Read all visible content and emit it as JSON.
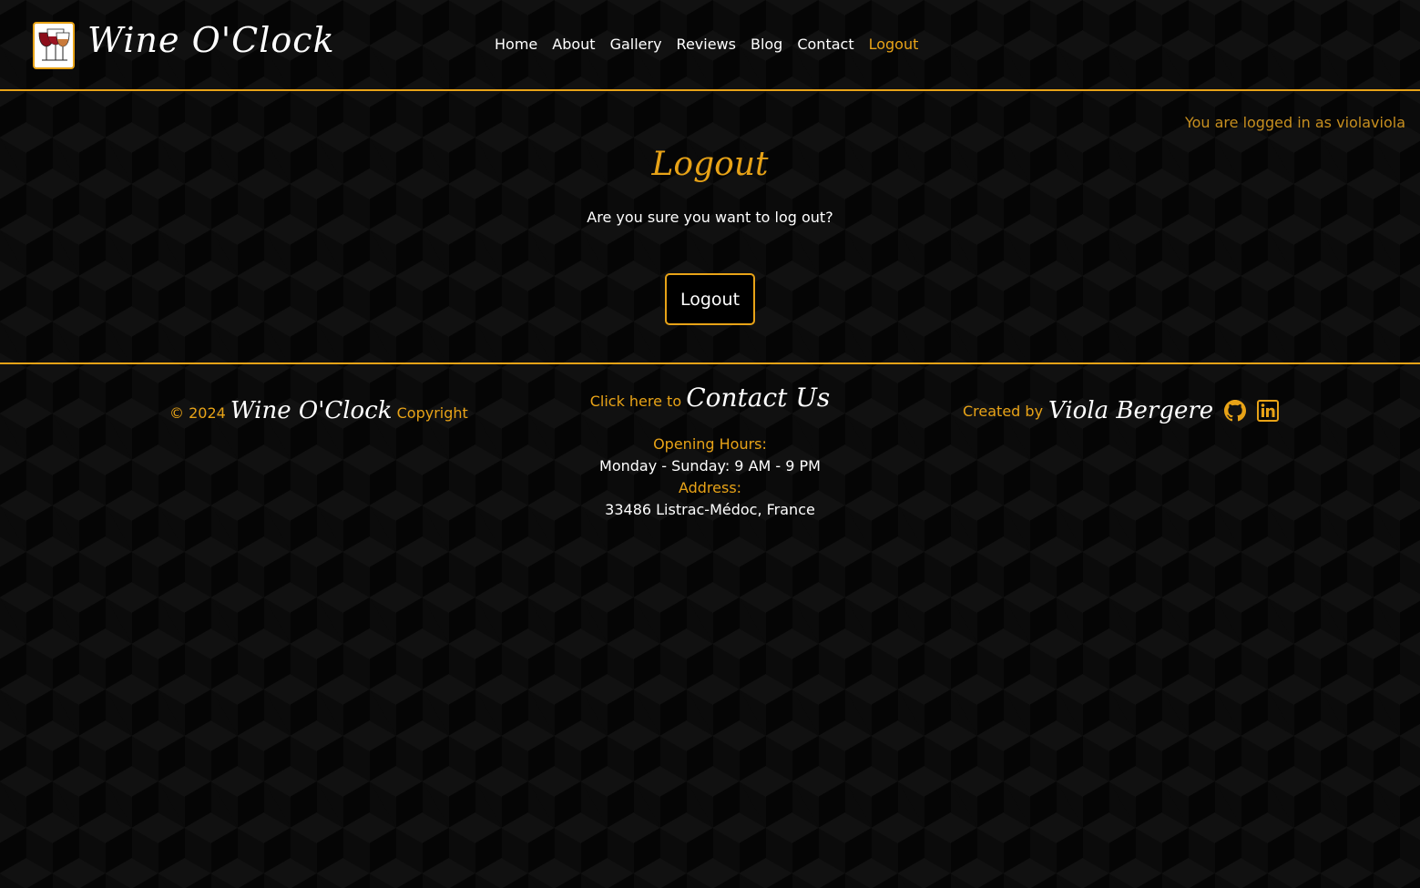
{
  "header": {
    "brand": "Wine O'Clock",
    "nav": [
      {
        "label": "Home"
      },
      {
        "label": "About"
      },
      {
        "label": "Gallery"
      },
      {
        "label": "Reviews"
      },
      {
        "label": "Blog"
      },
      {
        "label": "Contact"
      },
      {
        "label": "Logout",
        "active": true
      }
    ]
  },
  "main": {
    "status": "You are logged in as violaviola",
    "title": "Logout",
    "prompt": "Are you sure you want to log out?",
    "button_label": "Logout"
  },
  "footer": {
    "left": {
      "prefix": "© 2024",
      "brand": "Wine O'Clock",
      "suffix": "Copyright"
    },
    "middle": {
      "click_text": "Click here to",
      "contact_link": "Contact Us",
      "hours_label": "Opening Hours:",
      "hours_value": "Monday - Sunday: 9 AM - 9 PM",
      "address_label": "Address:",
      "address_value": "33486 Listrac-Médoc, France"
    },
    "right": {
      "created_by": "Created by",
      "author": "Viola Bergere",
      "icons": [
        "github-icon",
        "linkedin-icon"
      ]
    }
  },
  "colors": {
    "accent": "#e8a317",
    "background": "#050505",
    "text": "#ffffff"
  }
}
